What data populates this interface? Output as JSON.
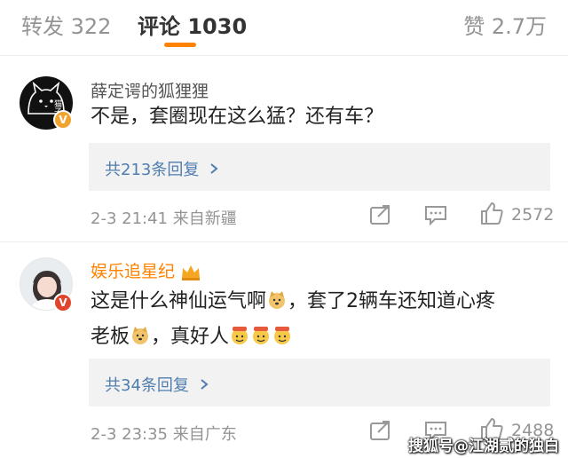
{
  "tabs": {
    "repost": "转发 322",
    "comment": "评论 1030",
    "like": "赞 2.7万"
  },
  "comments": [
    {
      "username": "薛定谔的狐狸狸",
      "avatar_text": "猫子",
      "text": "不是，套圈现在这么猛？还有车？",
      "replies_label": "共213条回复",
      "meta": "2-3 21:41 来自新疆",
      "likes": "2572"
    },
    {
      "username": "娱乐追星纪",
      "text_parts": [
        "这是什么神仙运气啊",
        "，套了2辆车还知道心疼",
        "老板",
        "，真好人"
      ],
      "replies_label": "共34条回复",
      "meta": "2-3 23:35 来自广东",
      "likes": "2488"
    }
  ],
  "watermark": "搜狐号@江湖贰的独白",
  "colors": {
    "accent": "#ff8200",
    "link": "#507daf",
    "muted": "#939393",
    "verified_gold": "#f0a32e",
    "verified_red": "#e0452c"
  },
  "icons": {
    "share": "share-icon",
    "reply": "comment-icon",
    "like": "thumbs-up-icon",
    "chevron": "chevron-right-icon",
    "crown": "crown-icon",
    "verified": "verified-badge-icon",
    "emoji_doge": "doge-emoji-icon",
    "emoji_666": "666-emoji-icon"
  }
}
